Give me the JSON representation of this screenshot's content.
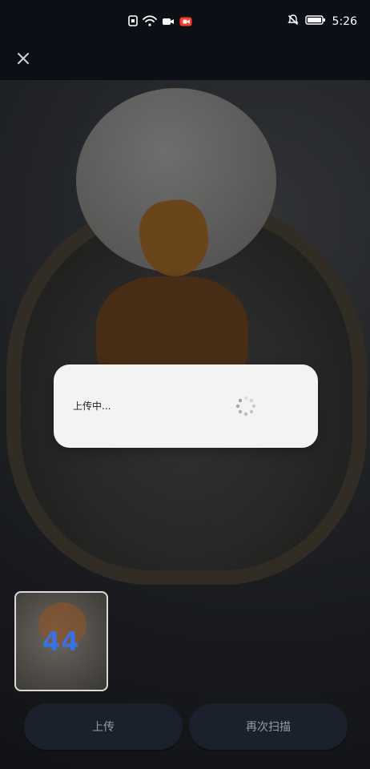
{
  "status_bar": {
    "time": "5:26"
  },
  "top_bar": {
    "close_icon": "close-icon"
  },
  "dialog": {
    "text": "上传中..."
  },
  "thumbnail": {
    "count": "44"
  },
  "buttons": {
    "upload_label": "上传",
    "rescan_label": "再次扫描"
  },
  "colors": {
    "background": "#0c0f16",
    "dialog_bg": "#f3f3f2",
    "button_bg": "#1a202c",
    "thumb_count": "#2f77ff"
  }
}
